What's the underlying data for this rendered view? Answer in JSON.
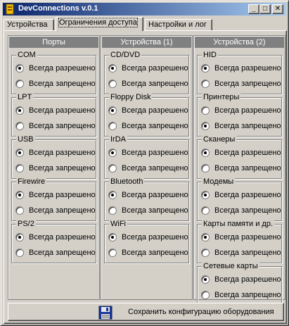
{
  "window": {
    "title": "DevConnections v.0.1",
    "buttons": {
      "minimize": "_",
      "maximize": "□",
      "close": "✕"
    }
  },
  "tabs": [
    {
      "label": "Устройства",
      "active": false
    },
    {
      "label": "Ограничения доступа",
      "active": true
    },
    {
      "label": "Настройки и лог",
      "active": false
    }
  ],
  "options": {
    "allow": "Всегда разрешено",
    "deny": "Всегда запрещено"
  },
  "columns": [
    {
      "header": "Порты",
      "groups": [
        {
          "title": "COM",
          "selected": "allow"
        },
        {
          "title": "LPT",
          "selected": "allow"
        },
        {
          "title": "USB",
          "selected": "allow"
        },
        {
          "title": "Firewire",
          "selected": "allow"
        },
        {
          "title": "PS/2",
          "selected": "allow"
        }
      ]
    },
    {
      "header": "Устройства (1)",
      "groups": [
        {
          "title": "CD/DVD",
          "selected": "allow"
        },
        {
          "title": "Floppy Disk",
          "selected": "allow"
        },
        {
          "title": "IrDA",
          "selected": "allow"
        },
        {
          "title": "Bluetooth",
          "selected": "allow"
        },
        {
          "title": "WiFi",
          "selected": "allow"
        }
      ]
    },
    {
      "header": "Устройства (2)",
      "groups": [
        {
          "title": "HID",
          "selected": "allow"
        },
        {
          "title": "Принтеры",
          "selected": "deny"
        },
        {
          "title": "Сканеры",
          "selected": "allow"
        },
        {
          "title": "Модемы",
          "selected": "allow"
        },
        {
          "title": "Карты памяти и др.",
          "selected": "allow"
        },
        {
          "title": "Сетевые карты",
          "selected": "allow"
        }
      ]
    }
  ],
  "footer": {
    "save_label": "Сохранить конфигурацию оборудования",
    "icon": "floppy-disk-icon"
  }
}
